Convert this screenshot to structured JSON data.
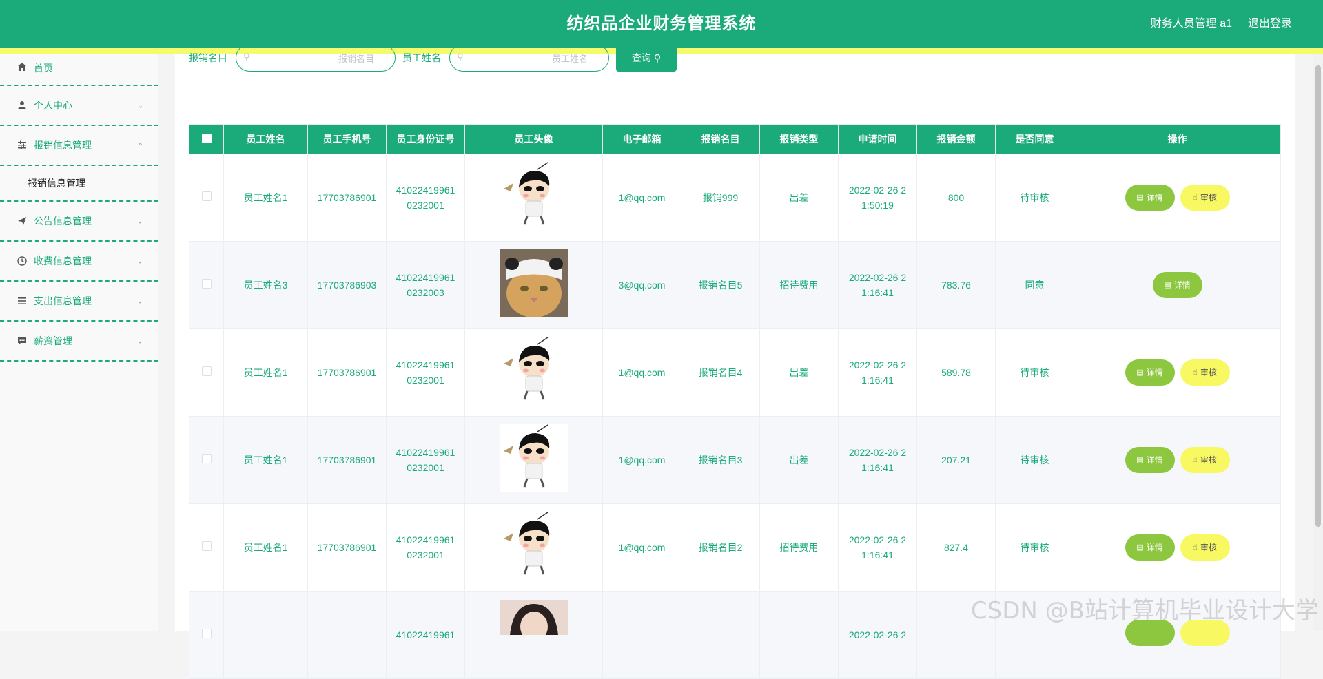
{
  "header": {
    "title": "纺织品企业财务管理系统",
    "user": "财务人员管理 a1",
    "logout": "退出登录"
  },
  "sidebar": {
    "items": [
      {
        "label": "首页",
        "icon": "home-icon"
      },
      {
        "label": "个人中心",
        "icon": "user-icon"
      },
      {
        "label": "报销信息管理",
        "icon": "sliders-icon",
        "open": true,
        "sub": "报销信息管理"
      },
      {
        "label": "公告信息管理",
        "icon": "send-icon"
      },
      {
        "label": "收费信息管理",
        "icon": "clock-icon"
      },
      {
        "label": "支出信息管理",
        "icon": "list-icon"
      },
      {
        "label": "薪资管理",
        "icon": "chat-icon"
      }
    ]
  },
  "search": {
    "label1": "报销名目",
    "placeholder1": "报销名目",
    "label2": "员工姓名",
    "placeholder2": "员工姓名",
    "button": "查询"
  },
  "table": {
    "headers": [
      "员工姓名",
      "员工手机号",
      "员工身份证号",
      "员工头像",
      "电子邮箱",
      "报销名目",
      "报销类型",
      "申请时间",
      "报销金额",
      "是否同意",
      "操作"
    ],
    "rows": [
      {
        "name": "员工姓名1",
        "phone": "17703786901",
        "id": "41022419961 0232001",
        "avatar": "cartoon",
        "email": "1@qq.com",
        "item": "报销999",
        "type": "出差",
        "time": "2022-02-26 2 1:50:19",
        "amount": "800",
        "status": "待审核"
      },
      {
        "name": "员工姓名3",
        "phone": "17703786903",
        "id": "41022419961 0232003",
        "avatar": "cat",
        "email": "3@qq.com",
        "item": "报销名目5",
        "type": "招待费用",
        "time": "2022-02-26 2 1:16:41",
        "amount": "783.76",
        "status": "同意"
      },
      {
        "name": "员工姓名1",
        "phone": "17703786901",
        "id": "41022419961 0232001",
        "avatar": "cartoon",
        "email": "1@qq.com",
        "item": "报销名目4",
        "type": "出差",
        "time": "2022-02-26 2 1:16:41",
        "amount": "589.78",
        "status": "待审核"
      },
      {
        "name": "员工姓名1",
        "phone": "17703786901",
        "id": "41022419961 0232001",
        "avatar": "cartoon",
        "email": "1@qq.com",
        "item": "报销名目3",
        "type": "出差",
        "time": "2022-02-26 2 1:16:41",
        "amount": "207.21",
        "status": "待审核"
      },
      {
        "name": "员工姓名1",
        "phone": "17703786901",
        "id": "41022419961 0232001",
        "avatar": "cartoon",
        "email": "1@qq.com",
        "item": "报销名目2",
        "type": "招待费用",
        "time": "2022-02-26 2 1:16:41",
        "amount": "827.4",
        "status": "待审核"
      },
      {
        "name": "",
        "phone": "",
        "id": "41022419961",
        "avatar": "photo",
        "email": "",
        "item": "",
        "type": "",
        "time": "2022-02-26 2",
        "amount": "",
        "status": ""
      }
    ],
    "detail_label": "详情",
    "audit_label": "审核"
  },
  "watermark": "CSDN @B站计算机毕业设计大学",
  "colors": {
    "primary": "#1bab7a",
    "strip": "#f5fb6a",
    "detail": "#8dc63f",
    "audit": "#f7f862"
  }
}
